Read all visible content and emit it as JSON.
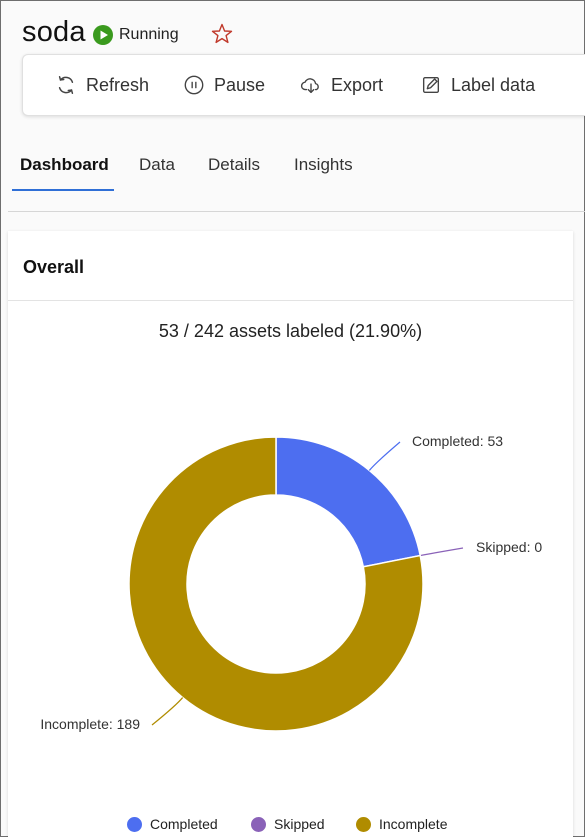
{
  "app": {
    "title": "soda",
    "status": "Running",
    "status_color": "#3a9a1e",
    "favorite_icon": "star-outline-icon"
  },
  "toolbar": {
    "buttons": [
      {
        "label": "Refresh",
        "icon": "refresh-icon"
      },
      {
        "label": "Pause",
        "icon": "pause-icon"
      },
      {
        "label": "Export",
        "icon": "cloud-export-icon"
      },
      {
        "label": "Label data",
        "icon": "edit-icon"
      }
    ]
  },
  "tabs": [
    {
      "label": "Dashboard",
      "active": true
    },
    {
      "label": "Data",
      "active": false
    },
    {
      "label": "Details",
      "active": false
    },
    {
      "label": "Insights",
      "active": false
    }
  ],
  "card": {
    "title": "Overall",
    "summary": "53 / 242 assets labeled (21.90%)"
  },
  "chart_data": {
    "type": "pie",
    "donut": true,
    "total": 242,
    "slices": [
      {
        "name": "Completed",
        "value": 53,
        "color": "#4d6ef0",
        "label": "Completed: 53"
      },
      {
        "name": "Skipped",
        "value": 0,
        "color": "#8a62b8",
        "label": "Skipped: 0"
      },
      {
        "name": "Incomplete",
        "value": 189,
        "color": "#b08c00",
        "label": "Incomplete: 189"
      }
    ],
    "legend": [
      "Completed",
      "Skipped",
      "Incomplete"
    ],
    "legend_position": "bottom"
  }
}
